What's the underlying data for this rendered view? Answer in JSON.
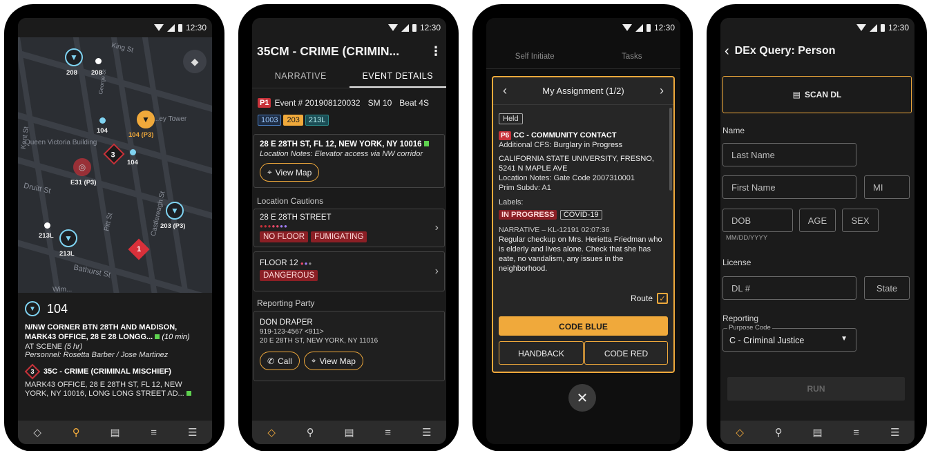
{
  "status": {
    "time": "12:30"
  },
  "nav": {
    "icons": [
      "diamond-icon",
      "map-pin-icon",
      "document-icon",
      "list-icon",
      "menu-icon"
    ]
  },
  "phone1": {
    "map": {
      "streets": [
        "King St",
        "Queen Victoria Building",
        "Druitt St",
        "Pitt St",
        "Castlereagh St",
        "Kent St",
        "George St",
        "Bathurst St",
        "Wim..."
      ],
      "tower_label": "...ey Tower",
      "units": [
        {
          "label": "208"
        },
        {
          "label": "208"
        },
        {
          "label": "104"
        },
        {
          "label": "104 (P3)"
        },
        {
          "label": "104"
        },
        {
          "label": "E31 (P3)"
        },
        {
          "label": "203 (P3)"
        },
        {
          "label": "213L"
        },
        {
          "label": "213L"
        }
      ],
      "incidents": [
        {
          "num": "3"
        },
        {
          "num": "1"
        }
      ]
    },
    "card": {
      "unit": "104",
      "address": "N/NW CORNER BTN 28TH AND MADISON, MARK43 OFFICE, 28 E 28 LONGG...",
      "eta": "(10 min)",
      "status": "AT SCENE",
      "status_time": "(5 hr)",
      "personnel": "Personnel: Rosetta Barber / Jose Martinez",
      "incident_num": "3",
      "incident_title": "35C - CRIME (CRIMINAL MISCHIEF)",
      "incident_addr": "MARK43 OFFICE, 28 E 28TH ST, FL 12, NEW YORK, NY 10016, LONG LONG STREET AD..."
    }
  },
  "phone2": {
    "title": "35CM - CRIME (CRIMIN...",
    "tabs": [
      "NARRATIVE",
      "EVENT DETAILS"
    ],
    "priority": "P1",
    "event": "Event # 201908120032",
    "sm": "SM 10",
    "beat": "Beat 4S",
    "codes": [
      "1003",
      "203",
      "213L"
    ],
    "address": "28 E 28TH ST, FL 12, NEW YORK, NY 10016",
    "location_notes_label": "Location Notes:",
    "location_notes": "Elevator access via NW corridor",
    "view_map": "View Map",
    "cautions_header": "Location Cautions",
    "caution1": {
      "title": "28 E 28TH STREET",
      "labels": [
        "NO FLOOR",
        "FUMIGATING"
      ]
    },
    "caution2": {
      "title": "FLOOR 12",
      "labels": [
        "DANGEROUS"
      ]
    },
    "reporting_header": "Reporting Party",
    "party": {
      "name": "DON DRAPER",
      "phone": "919-123-4567 <911>",
      "addr": "20 E 28TH ST, NEW YORK, NY 11016"
    },
    "call": "Call",
    "view_map2": "View Map"
  },
  "phone3": {
    "tabs": [
      "Self Initiate",
      "Tasks"
    ],
    "modal": {
      "title": "My Assignment (1/2)",
      "status": "Held",
      "priority": "P6",
      "call_type": "CC - COMMUNITY CONTACT",
      "cfs_label": "Additional CFS:",
      "cfs": "Burglary in Progress",
      "location": "CALIFORNIA STATE UNIVERSITY, FRESNO, 5241 N MAPLE AVE",
      "notes_label": "Location Notes:",
      "notes": "Gate Code 2007310001",
      "subdv_label": "Prim Subdv:",
      "subdv": "A1",
      "labels_header": "Labels:",
      "labels": [
        "IN PROGRESS",
        "COVID-19"
      ],
      "narrative_header": "NARRATIVE – KL-12191  02:07:36",
      "narrative": "Regular checkup on Mrs. Herietta Friedman who is elderly and lives alone. Check that she has eate, no vandalism, any issues in the neighborhood.",
      "route": "Route",
      "code_blue": "CODE BLUE",
      "handback": "HANDBACK",
      "code_red": "CODE RED"
    }
  },
  "phone4": {
    "title": "DEx Query: Person",
    "scan": "SCAN DL",
    "name_header": "Name",
    "last_name": "Last Name",
    "first_name": "First Name",
    "mi": "MI",
    "dob": "DOB",
    "age": "AGE",
    "sex": "SEX",
    "dob_hint": "MM/DD/YYYY",
    "license_header": "License",
    "dl": "DL #",
    "state": "State",
    "reporting_header": "Reporting",
    "purpose_label": "Purpose Code",
    "purpose_value": "C - Criminal Justice",
    "run": "RUN"
  }
}
